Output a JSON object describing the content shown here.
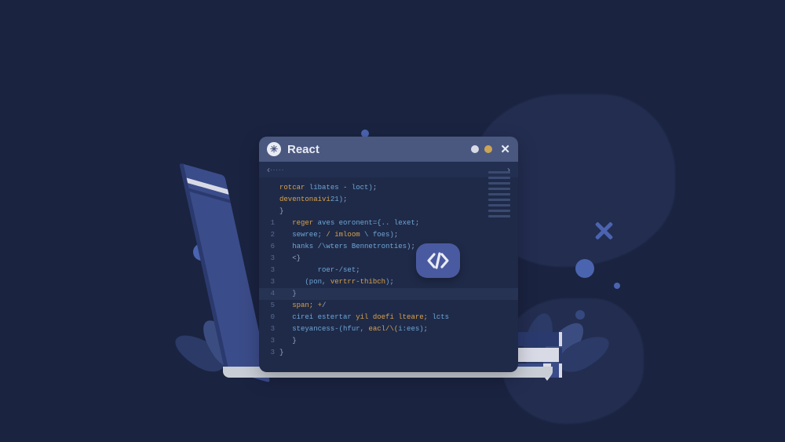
{
  "window": {
    "title": "React",
    "breadcrumb_path": "·····",
    "breadcrumb_glyph_left": "‹",
    "breadcrumb_glyph_right": "›"
  },
  "gutter": [
    "",
    "",
    "",
    "1",
    "2",
    "6",
    "3",
    "3",
    "3",
    "4",
    "5",
    "0",
    "3",
    "3",
    "3"
  ],
  "code": [
    {
      "indent": 0,
      "html": "<span class='kw'>rotcar</span> <span class='fn'>libates</span> - <span class='fn'>loct)</span>;"
    },
    {
      "indent": 0,
      "html": "<span class='kw'>deventonaivi</span><span class='fn'>21)</span>;"
    },
    {
      "indent": 0,
      "html": "<span class='pu'>}</span>"
    },
    {
      "indent": 1,
      "html": "<span class='kw'>reger</span> <span class='fn'>aves eoronent={.. lexet</span>;"
    },
    {
      "indent": 1,
      "html": "<span class='fn'>sewree;</span> <span class='kw'>/ imloom</span> <span class='fn'>\\ foes)</span>;"
    },
    {
      "indent": 1,
      "html": "<span class='fn'>hanks /\\wters Bennetronties)</span>;"
    },
    {
      "indent": 1,
      "html": "<span class='pu'>&lt;}</span>"
    },
    {
      "indent": 3,
      "html": "<span class='fn'>roer-/set</span>;"
    },
    {
      "indent": 2,
      "html": "<span class='fn'>(pon,</span> <span class='kw'>vertrr-thibch</span><span class='fn'>)</span>;"
    },
    {
      "indent": 1,
      "html": "<span class='pu'>}</span>"
    },
    {
      "indent": 1,
      "html": "<span class='kw'>span; +</span><span class='pu'>/</span>"
    },
    {
      "indent": 1,
      "html": "<span class='fn'>cirei estertar</span> <span class='kw'>yil doefi lteare;</span> <span class='fn'>lcts</span>"
    },
    {
      "indent": 1,
      "html": "<span class='fn'>steyancess-(hfur,</span> <span class='kw'>eacl/\\(</span><span class='fn'>i:ees)</span>;"
    },
    {
      "indent": 1,
      "html": "<span class='pu'>}</span>"
    },
    {
      "indent": 0,
      "html": "<span class='pu'>}</span>"
    }
  ],
  "icons": {
    "logo_glyph": "✳",
    "close_glyph": "✕",
    "badge_label": "</>"
  }
}
